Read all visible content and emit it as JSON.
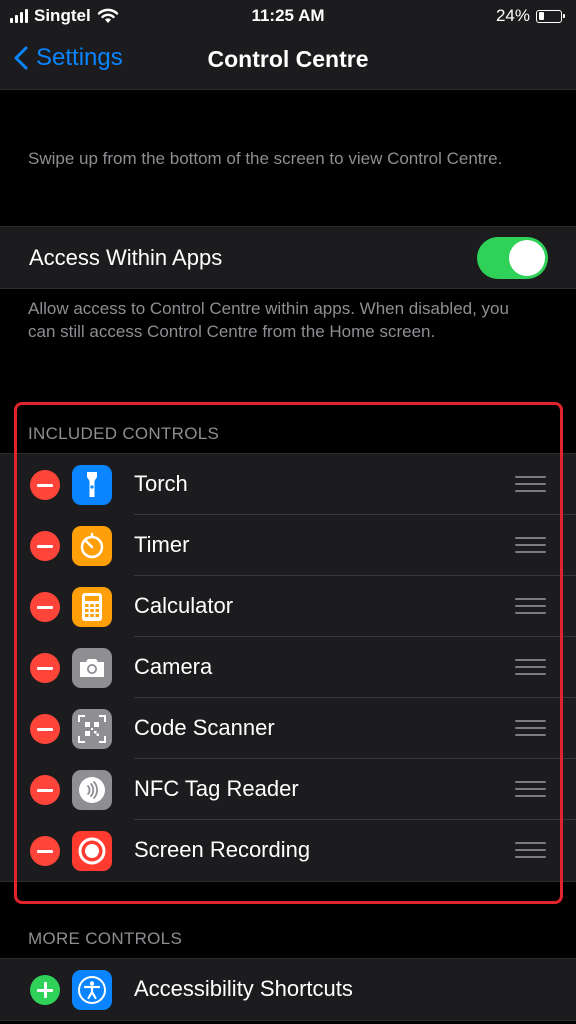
{
  "status_bar": {
    "carrier": "Singtel",
    "time": "11:25 AM",
    "battery_percent": "24%",
    "battery_level": 0.24
  },
  "nav": {
    "back_label": "Settings",
    "title": "Control Centre"
  },
  "intro_text": "Swipe up from the bottom of the screen to view Control Centre.",
  "access_within_apps": {
    "label": "Access Within Apps",
    "enabled": true,
    "description": "Allow access to Control Centre within apps. When disabled, you can still access Control Centre from the Home screen."
  },
  "included_controls": {
    "header": "INCLUDED CONTROLS",
    "items": [
      {
        "label": "Torch",
        "icon": "torch-icon",
        "icon_color": "#0a84ff"
      },
      {
        "label": "Timer",
        "icon": "timer-icon",
        "icon_color": "#ff9f0a"
      },
      {
        "label": "Calculator",
        "icon": "calculator-icon",
        "icon_color": "#ff9f0a"
      },
      {
        "label": "Camera",
        "icon": "camera-icon",
        "icon_color": "#8e8e93"
      },
      {
        "label": "Code Scanner",
        "icon": "qr-code-icon",
        "icon_color": "#8e8e93"
      },
      {
        "label": "NFC Tag Reader",
        "icon": "nfc-icon",
        "icon_color": "#8e8e93"
      },
      {
        "label": "Screen Recording",
        "icon": "screen-recording-icon",
        "icon_color": "#ff3b30"
      }
    ]
  },
  "more_controls": {
    "header": "MORE CONTROLS",
    "items": [
      {
        "label": "Accessibility Shortcuts",
        "icon": "accessibility-icon",
        "icon_color": "#0a84ff"
      }
    ]
  },
  "colors": {
    "accent": "#0a84ff",
    "toggle_on": "#30d158",
    "remove": "#ff453a",
    "highlight": "#e0242e"
  }
}
